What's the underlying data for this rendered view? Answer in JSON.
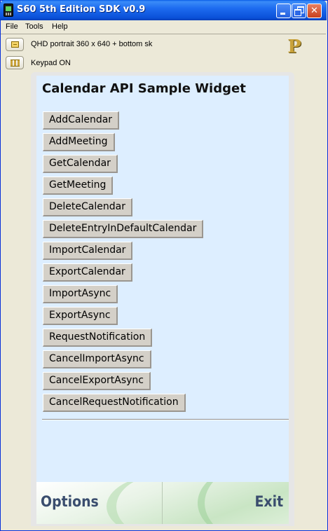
{
  "window": {
    "title": "S60 5th Edition SDK v0.9"
  },
  "menu": [
    "File",
    "Tools",
    "Help"
  ],
  "toolbar": {
    "resolution_label": "QHD portrait 360 x 640 + bottom sk",
    "keypad_label": "Keypad ON"
  },
  "widget": {
    "title": "Calendar API Sample Widget",
    "buttons": [
      "AddCalendar",
      "AddMeeting",
      "GetCalendar",
      "GetMeeting",
      "DeleteCalendar",
      "DeleteEntryInDefaultCalendar",
      "ImportCalendar",
      "ExportCalendar",
      "ImportAsync",
      "ExportAsync",
      "RequestNotification",
      "CancelImportAsync",
      "CancelExportAsync",
      "CancelRequestNotification"
    ]
  },
  "softkeys": {
    "left": "Options",
    "right": "Exit"
  }
}
